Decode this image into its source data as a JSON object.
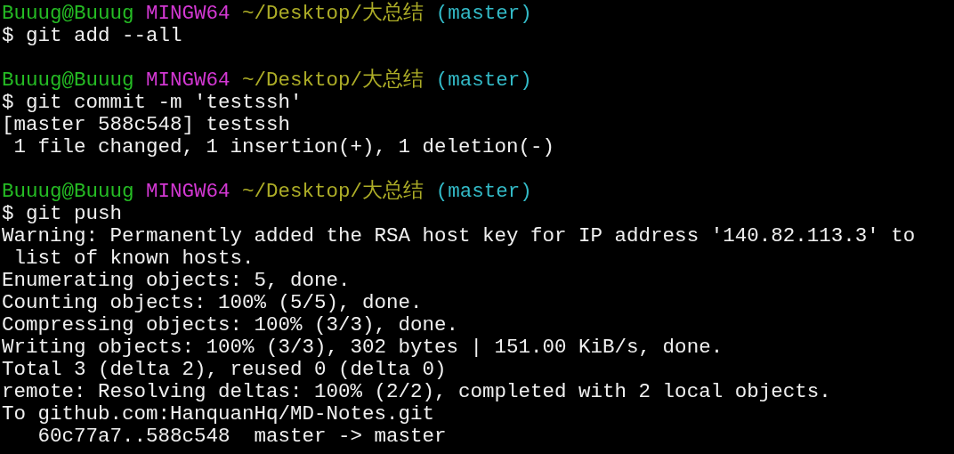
{
  "terminal": {
    "lines": [
      {
        "kind": "prompt",
        "user": "Buuug@Buuug",
        "system": "MINGW64",
        "path": "~/Desktop/大总结",
        "branch": "(master)"
      },
      {
        "kind": "output",
        "text": "$ git add --all"
      },
      {
        "kind": "blank"
      },
      {
        "kind": "prompt",
        "user": "Buuug@Buuug",
        "system": "MINGW64",
        "path": "~/Desktop/大总结",
        "branch": "(master)"
      },
      {
        "kind": "output",
        "text": "$ git commit -m 'testssh'"
      },
      {
        "kind": "output",
        "text": "[master 588c548] testssh"
      },
      {
        "kind": "output",
        "text": " 1 file changed, 1 insertion(+), 1 deletion(-)"
      },
      {
        "kind": "blank"
      },
      {
        "kind": "prompt",
        "user": "Buuug@Buuug",
        "system": "MINGW64",
        "path": "~/Desktop/大总结",
        "branch": "(master)"
      },
      {
        "kind": "output",
        "text": "$ git push"
      },
      {
        "kind": "output",
        "text": "Warning: Permanently added the RSA host key for IP address '140.82.113.3' to"
      },
      {
        "kind": "output",
        "text": " list of known hosts."
      },
      {
        "kind": "output",
        "text": "Enumerating objects: 5, done."
      },
      {
        "kind": "output",
        "text": "Counting objects: 100% (5/5), done."
      },
      {
        "kind": "output",
        "text": "Compressing objects: 100% (3/3), done."
      },
      {
        "kind": "output",
        "text": "Writing objects: 100% (3/3), 302 bytes | 151.00 KiB/s, done."
      },
      {
        "kind": "output",
        "text": "Total 3 (delta 2), reused 0 (delta 0)"
      },
      {
        "kind": "output",
        "text": "remote: Resolving deltas: 100% (2/2), completed with 2 local objects."
      },
      {
        "kind": "output",
        "text": "To github.com:HanquanHq/MD-Notes.git"
      },
      {
        "kind": "output",
        "text": "   60c77a7..588c548  master -> master"
      }
    ]
  }
}
